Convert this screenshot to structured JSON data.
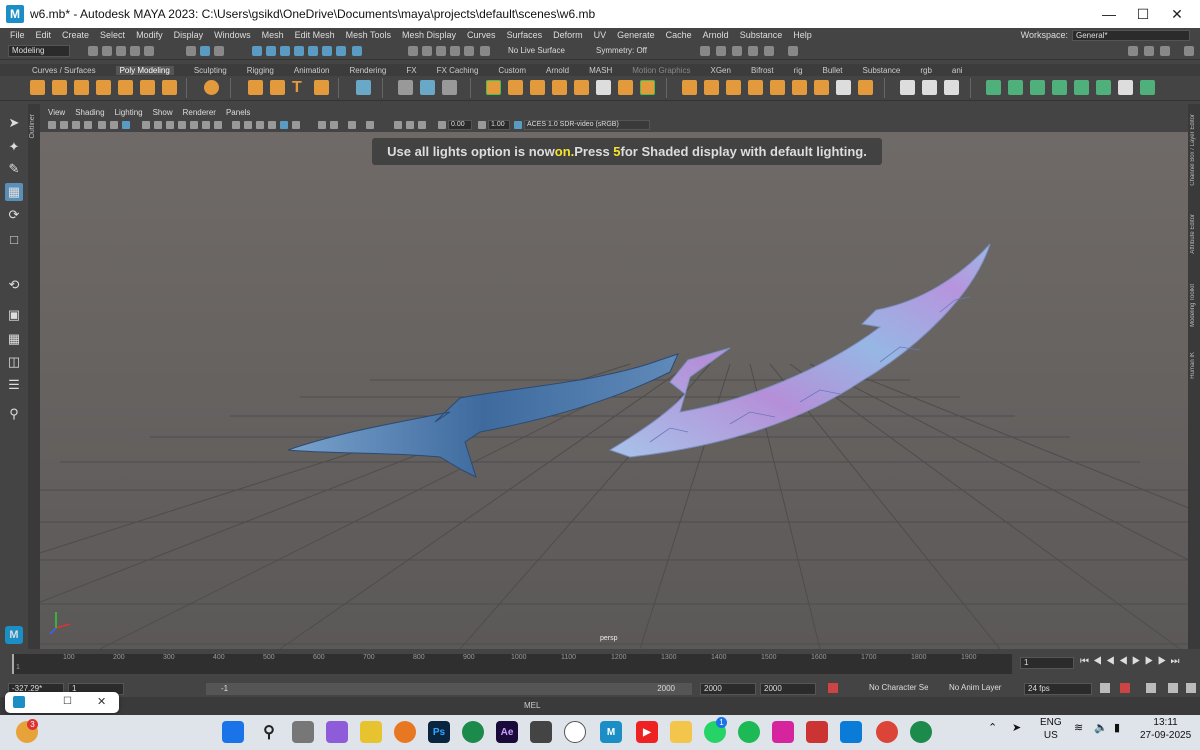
{
  "window": {
    "title": "w6.mb* - Autodesk MAYA 2023: C:\\Users\\gsikd\\OneDrive\\Documents\\maya\\projects\\default\\scenes\\w6.mb",
    "app_icon": "M"
  },
  "menu": [
    "File",
    "Edit",
    "Create",
    "Select",
    "Modify",
    "Display",
    "Windows",
    "Mesh",
    "Edit Mesh",
    "Mesh Tools",
    "Mesh Display",
    "Curves",
    "Surfaces",
    "Deform",
    "UV",
    "Generate",
    "Cache",
    "Arnold",
    "Substance",
    "Help"
  ],
  "workspace": {
    "label": "Workspace:",
    "value": "General*"
  },
  "status_line": {
    "mode": "Modeling",
    "live_surface": "No Live Surface",
    "symmetry": "Symmetry: Off"
  },
  "shelf_tabs": [
    "Curves / Surfaces",
    "Poly Modeling",
    "Sculpting",
    "Rigging",
    "Animation",
    "Rendering",
    "FX",
    "FX Caching",
    "Custom",
    "Arnold",
    "MASH",
    "Motion Graphics",
    "XGen",
    "Bifrost",
    "rig",
    "Bullet",
    "Substance",
    "rgb",
    "ani"
  ],
  "active_shelf_tab": "Poly Modeling",
  "panel_menu": [
    "View",
    "Shading",
    "Lighting",
    "Show",
    "Renderer",
    "Panels"
  ],
  "panel_toolbar": {
    "exposure": "0.00",
    "gamma": "1.00",
    "color_space": "ACES 1.0 SDR-video (sRGB)"
  },
  "hud": {
    "prefix": "Use all lights option is now ",
    "highlight1": "on.",
    "middle": "Press ",
    "highlight2": "5",
    "suffix": " for Shaded display with default lighting."
  },
  "camera_label": "persp",
  "outliner_tab": "Outliner",
  "right_tabs": [
    "Channel Box / Layer Editor",
    "Attribute Editor",
    "Modeling Toolkit",
    "Human IK"
  ],
  "timeline": {
    "ticks": [
      "100",
      "200",
      "300",
      "400",
      "500",
      "600",
      "700",
      "800",
      "900",
      "1000",
      "1100",
      "1200",
      "1300",
      "1400",
      "1500",
      "1600",
      "1700",
      "1800",
      "1900"
    ],
    "start_mark": "1",
    "current_frame": "1"
  },
  "range": {
    "coord": "-327.29*",
    "start": "1",
    "inner_start": "-1",
    "inner_end": "2000",
    "end": "2000",
    "end2": "2000",
    "char_set": "No Character Set",
    "anim_layer": "No Anim Layer",
    "fps": "24 fps"
  },
  "mel_label": "MEL",
  "taskbar": {
    "badge_count": "3",
    "whatsapp_badge": "1",
    "lang": "ENG",
    "region": "US",
    "time": "13:11",
    "date": "27-09-2025",
    "icons": [
      "Ps",
      "Ae"
    ]
  }
}
